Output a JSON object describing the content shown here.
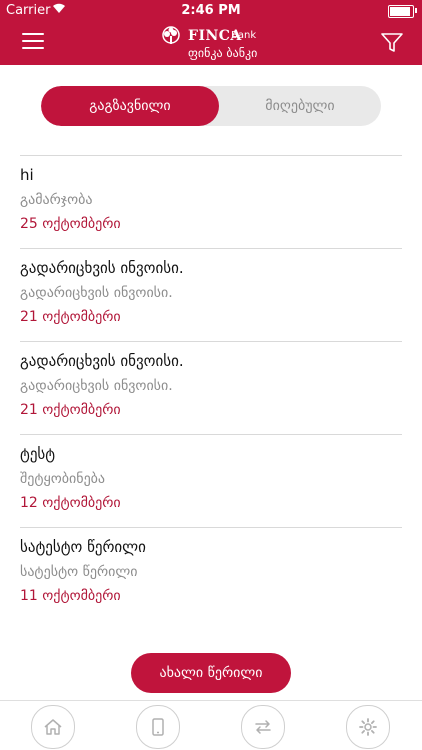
{
  "status_bar": {
    "carrier": "Carrier",
    "time": "2:46 PM"
  },
  "header": {
    "logo": {
      "finca": "FINCA",
      "bank": "Bank",
      "geo": "ფინკა ბანკი"
    }
  },
  "segment": {
    "sent": "გაგზავნილი",
    "received": "მიღებული"
  },
  "messages": [
    {
      "title": "hi",
      "subtitle": "გამარჯობა",
      "date": "25 ოქტომბერი"
    },
    {
      "title": "გადარიცხვის ინვოისი.",
      "subtitle": "გადარიცხვის ინვოისი.",
      "date": "21 ოქტომბერი"
    },
    {
      "title": "გადარიცხვის ინვოისი.",
      "subtitle": "გადარიცხვის ინვოისი.",
      "date": "21 ოქტომბერი"
    },
    {
      "title": "ტესტ",
      "subtitle": "შეტყობინება",
      "date": "12 ოქტომბერი"
    },
    {
      "title": "სატესტო წერილი",
      "subtitle": "სატესტო წერილი",
      "date": "11 ოქტომბერი"
    }
  ],
  "new_button": "ახალი წერილი",
  "tabs": [
    "home-icon",
    "mobile-device-icon",
    "transfer-arrows-icon",
    "settings-gear-icon"
  ],
  "colors": {
    "primary": "#c0143c",
    "date": "#b11638",
    "muted": "#8d8d8d"
  }
}
